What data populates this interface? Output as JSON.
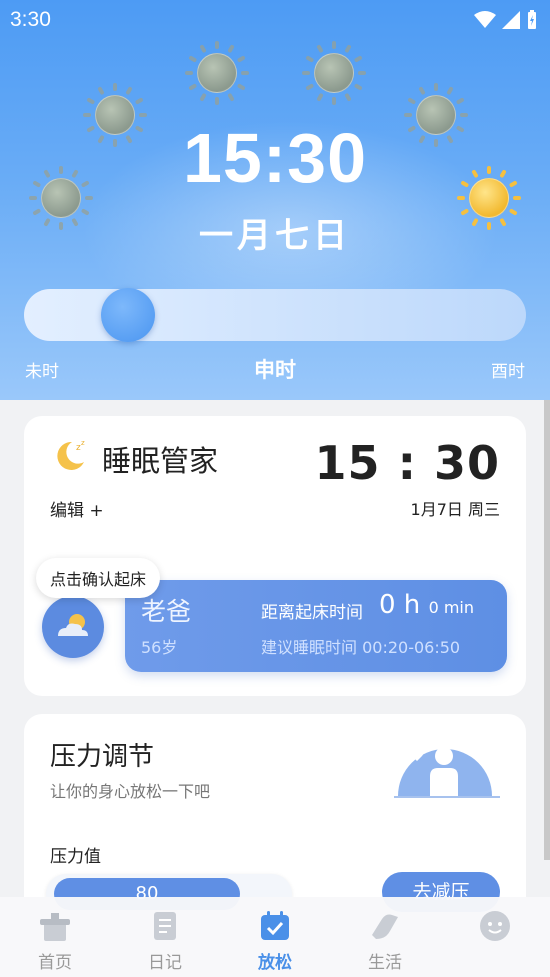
{
  "status_bar": {
    "time": "3:30"
  },
  "header": {
    "time": "15:30",
    "date": "一月七日",
    "slider": {
      "left_label": "未时",
      "center_label": "申时",
      "right_label": "酉时",
      "position": 0.17
    }
  },
  "sleep_card": {
    "title": "睡眠管家",
    "clock": "15 : 30",
    "edit_label": "编辑 +",
    "date": "1月7日 周三",
    "tooltip": "点击确认起床",
    "member": {
      "name": "老爸",
      "age": "56岁",
      "until_label": "距离起床时间",
      "hours": "0 h",
      "minutes": "0 min",
      "suggest": "建议睡眠时间 00:20-06:50"
    }
  },
  "stress_card": {
    "title": "压力调节",
    "subtitle": "让你的身心放松一下吧",
    "value_label": "压力值",
    "value": "80",
    "button": "去减压"
  },
  "bottom_nav": {
    "items": [
      {
        "label": "首页",
        "icon": "home-icon"
      },
      {
        "label": "日记",
        "icon": "diary-icon"
      },
      {
        "label": "放松",
        "icon": "relax-icon",
        "active": true
      },
      {
        "label": "生活",
        "icon": "life-icon"
      },
      {
        "label": "",
        "icon": "face-icon"
      }
    ]
  },
  "colors": {
    "accent": "#4a90e8",
    "card_blue": "#5f8fe4",
    "sky": "#4d9bf4"
  }
}
